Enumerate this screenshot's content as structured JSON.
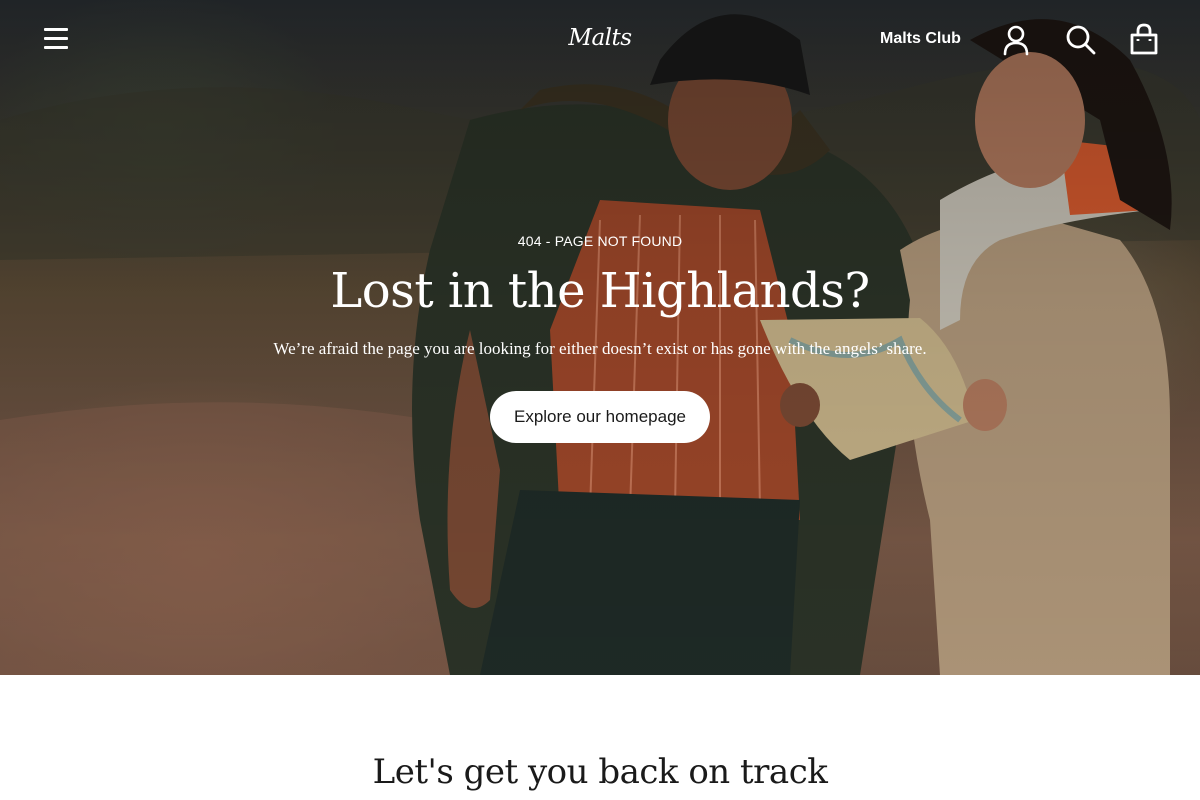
{
  "header": {
    "logo": "Malts",
    "club_link": "Malts Club",
    "icons": [
      "menu-icon",
      "account-icon",
      "search-icon",
      "bag-icon"
    ]
  },
  "hero": {
    "eyebrow": "404 - PAGE NOT FOUND",
    "title": "Lost in the Highlands?",
    "subtitle": "We’re afraid the page you are looking for either doesn’t exist or has gone with the angels’ share.",
    "cta_label": "Explore our homepage"
  },
  "section": {
    "title": "Let's get you back on track"
  },
  "colors": {
    "text_on_hero": "#ffffff",
    "cta_background": "#ffffff",
    "cta_text": "#1a1a1a",
    "page_background": "#ffffff",
    "heading_dark": "#1a1a1a"
  }
}
